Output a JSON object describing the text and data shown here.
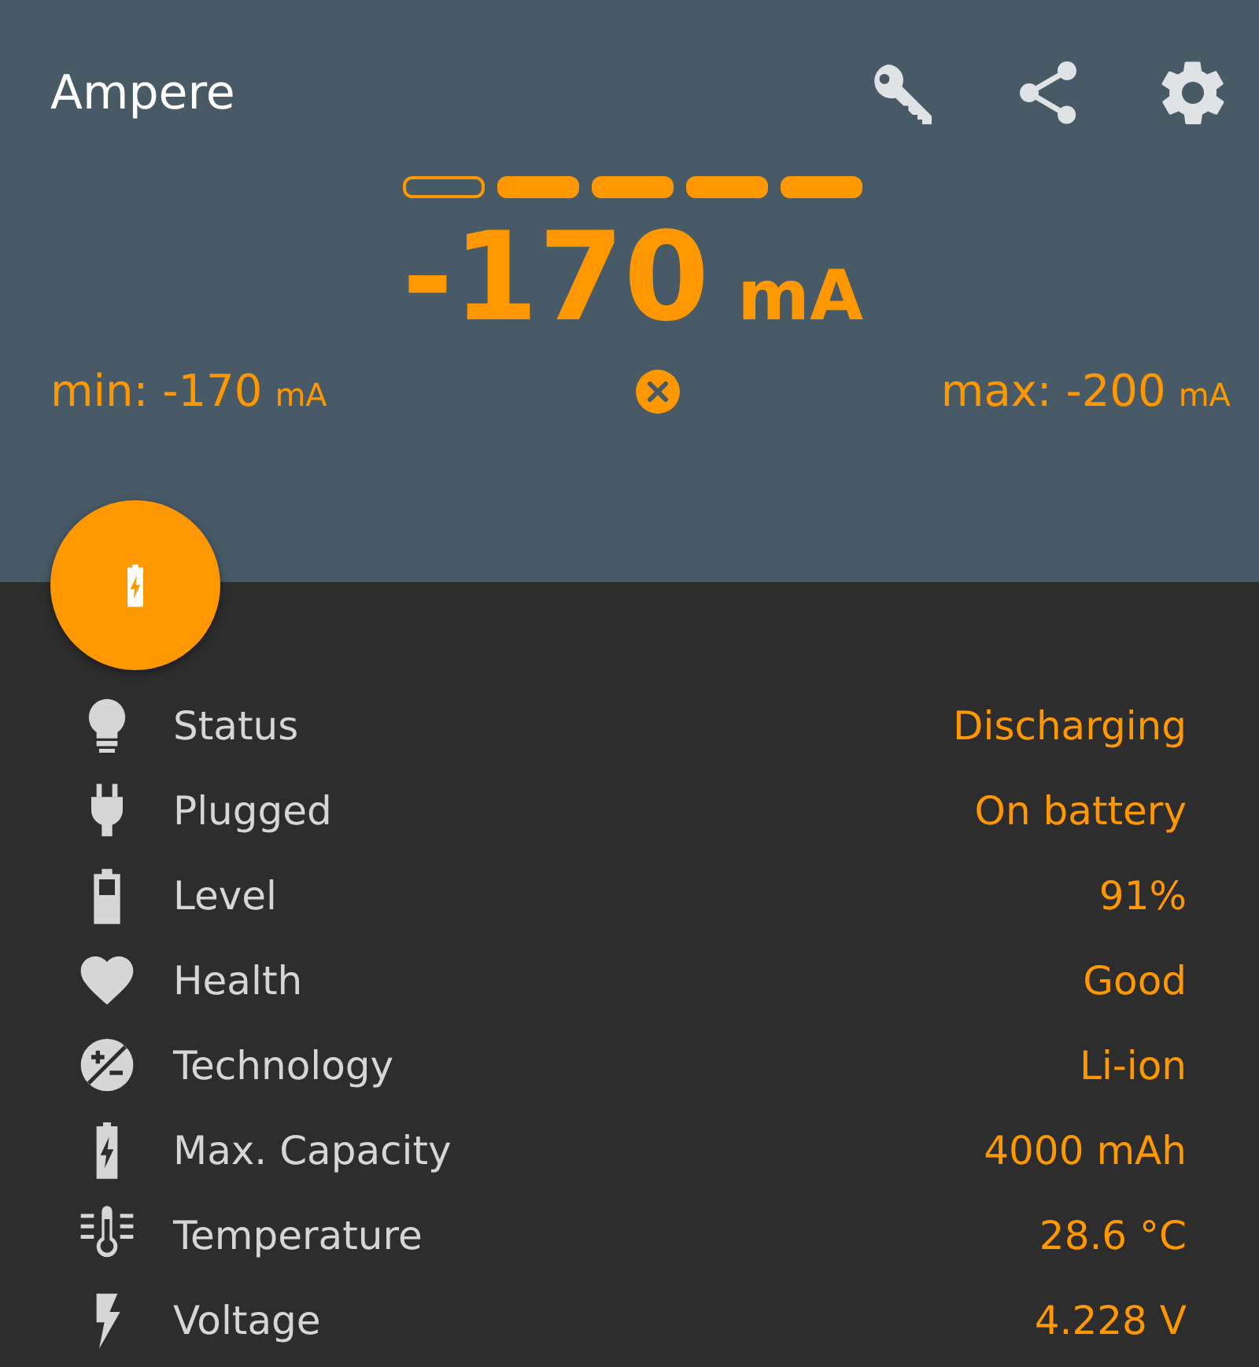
{
  "app_bar": {
    "title": "Ampere"
  },
  "meter": {
    "segments": [
      {
        "on": false
      },
      {
        "on": true
      },
      {
        "on": true
      },
      {
        "on": true
      },
      {
        "on": true
      }
    ],
    "value": "-170",
    "unit": "mA",
    "min": {
      "text": "min: -170",
      "unit": "mA"
    },
    "max": {
      "text": "max: -200",
      "unit": "mA"
    }
  },
  "details": [
    {
      "label": "Status",
      "value": "Discharging"
    },
    {
      "label": "Plugged",
      "value": "On battery"
    },
    {
      "label": "Level",
      "value": "91%"
    },
    {
      "label": "Health",
      "value": "Good"
    },
    {
      "label": "Technology",
      "value": "Li-ion"
    },
    {
      "label": "Max. Capacity",
      "value": "4000 mAh"
    },
    {
      "label": "Temperature",
      "value": "28.6 °C"
    },
    {
      "label": "Voltage",
      "value": "4.228 V"
    }
  ]
}
